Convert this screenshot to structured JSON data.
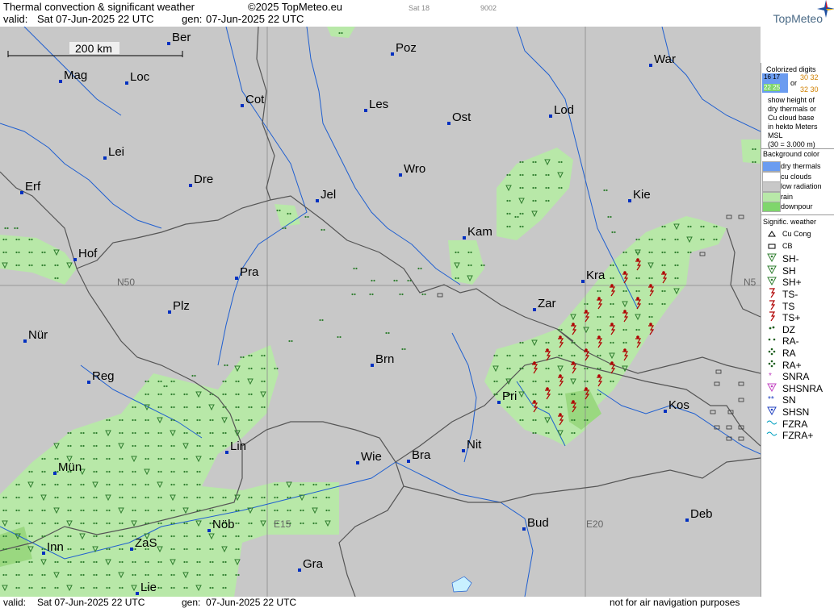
{
  "header": {
    "title": "Thermal convection & significant weather",
    "copyright": "©2025 TopMeteo.eu",
    "model": "Sat 18",
    "code": "9002",
    "valid_label": "valid:",
    "valid_value": "Sat  07-Jun-2025  22 UTC",
    "gen_label": "gen:",
    "gen_value": "07-Jun-2025 22 UTC"
  },
  "logo": {
    "name": "TopMeteo",
    "colors": {
      "star_blue": "#1e4fa0",
      "star_red": "#c8102e",
      "star_yellow": "#f2b705"
    }
  },
  "footer": {
    "valid_label": "valid:",
    "valid_value": "Sat  07-Jun-2025  22 UTC",
    "gen_label": "gen:",
    "gen_value": "07-Jun-2025 22 UTC",
    "disclaimer": "not for air navigation purposes"
  },
  "map": {
    "scale_label": "200 km",
    "colors": {
      "background": "#c8c8c8",
      "rain": "#b8e8a8",
      "downpour": "#9ad880",
      "river": "#1f5fd0",
      "border": "#555555",
      "city": "#0030c0",
      "symbol_green": "#2e7d2e",
      "symbol_red": "#b00000"
    },
    "grid_labels": [
      "N50",
      "N5",
      "E15",
      "E20"
    ],
    "cities": [
      "Ber",
      "Poz",
      "Mag",
      "Loc",
      "Cot",
      "Les",
      "Ost",
      "Lod",
      "War",
      "Lei",
      "Dre",
      "Wro",
      "Jel",
      "Kie",
      "Erf",
      "Kam",
      "Hof",
      "Pra",
      "Kra",
      "N50",
      "Zar",
      "Plz",
      "Nür",
      "Brn",
      "Reg",
      "Pri",
      "Kos",
      "Nit",
      "Lin",
      "Mün",
      "Wie",
      "Bra",
      "Nöb",
      "Inn",
      "ZaS",
      "Bud",
      "Deb",
      "Gra",
      "Lie"
    ]
  },
  "legend": {
    "colorized_title": "Colorized digits",
    "digit_samples": [
      "16 17",
      "22 25",
      "or",
      "30 32",
      "32 30"
    ],
    "description": [
      "show height of",
      "dry thermals or",
      "Cu cloud base",
      "in hekto Meters",
      "MSL",
      "(30 = 3.000 m)"
    ],
    "background_title": "Background color",
    "background_items": [
      {
        "label": "dry thermals",
        "color": "#6b9cf0"
      },
      {
        "label": "cu clouds",
        "color": "#ffffff"
      },
      {
        "label": "low radiation",
        "color": "#c8c8c8"
      },
      {
        "label": "rain",
        "color": "#b8e8a8"
      },
      {
        "label": "downpour",
        "color": "#7fd66c"
      }
    ],
    "weather_title": "Signific. weather",
    "weather_items": [
      {
        "label": "Cu Cong",
        "icon": "cu-cong-icon",
        "color": "#000000"
      },
      {
        "label": "CB",
        "icon": "cb-icon",
        "color": "#000000"
      },
      {
        "label": "SH-",
        "icon": "shower-light-icon",
        "color": "#2e7d2e"
      },
      {
        "label": "SH",
        "icon": "shower-icon",
        "color": "#2e7d2e"
      },
      {
        "label": "SH+",
        "icon": "shower-heavy-icon",
        "color": "#2e7d2e"
      },
      {
        "label": "TS-",
        "icon": "thunderstorm-light-icon",
        "color": "#b00000"
      },
      {
        "label": "TS",
        "icon": "thunderstorm-icon",
        "color": "#b00000"
      },
      {
        "label": "TS+",
        "icon": "thunderstorm-heavy-icon",
        "color": "#b00000"
      },
      {
        "label": "DZ",
        "icon": "drizzle-icon",
        "color": "#1b5e1b"
      },
      {
        "label": "RA-",
        "icon": "rain-light-icon",
        "color": "#1b5e1b"
      },
      {
        "label": "RA",
        "icon": "rain-icon",
        "color": "#1b5e1b"
      },
      {
        "label": "RA+",
        "icon": "rain-heavy-icon",
        "color": "#1b5e1b"
      },
      {
        "label": "SNRA",
        "icon": "snow-rain-icon",
        "color": "#c040c0"
      },
      {
        "label": "SHSNRA",
        "icon": "snow-rain-shower-icon",
        "color": "#c040c0"
      },
      {
        "label": "SN",
        "icon": "snow-icon",
        "color": "#2040c0"
      },
      {
        "label": "SHSN",
        "icon": "snow-shower-icon",
        "color": "#2040c0"
      },
      {
        "label": "FZRA",
        "icon": "freezing-rain-icon",
        "color": "#00a0c0"
      },
      {
        "label": "FZRA+",
        "icon": "freezing-rain-heavy-icon",
        "color": "#00a0c0"
      }
    ]
  }
}
